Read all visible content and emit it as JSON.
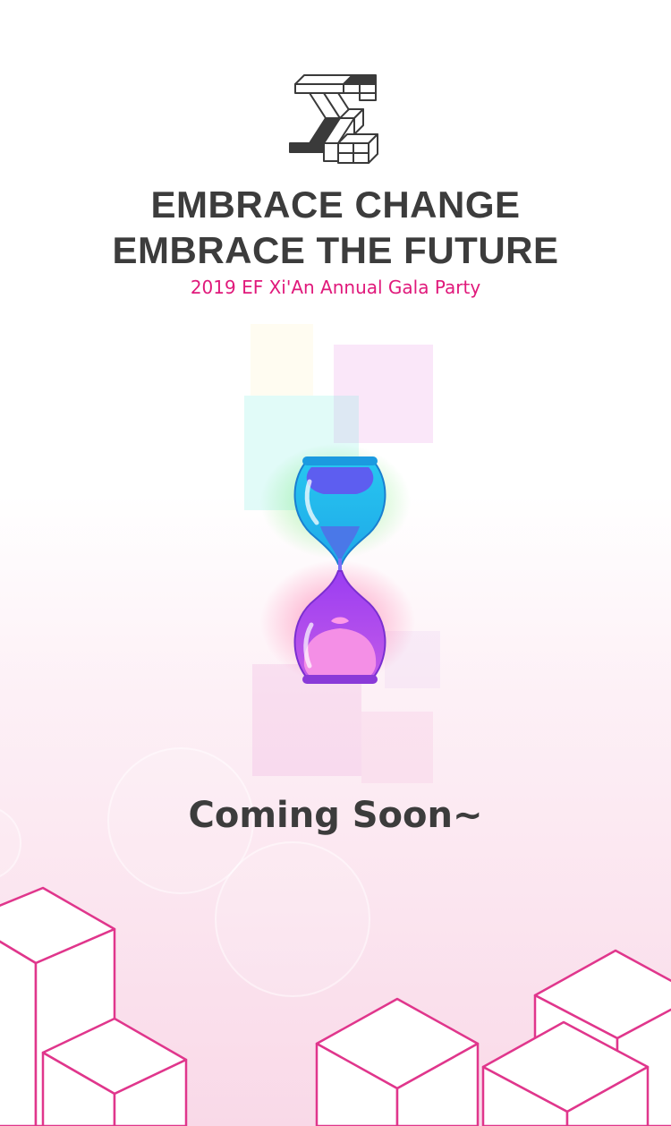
{
  "headline": {
    "line1": "EMBRACE CHANGE",
    "line2": "EMBRACE THE FUTURE"
  },
  "subtitle": "2019 EF Xi'An Annual Gala Party",
  "status_text": "Coming Soon~",
  "colors": {
    "text_dark": "#3c3c3c",
    "accent_pink": "#e0197b",
    "cube_outline": "#e0368c"
  },
  "icons": {
    "logo": "stacked-cube-logo-icon",
    "centerpiece": "hourglass-icon"
  }
}
